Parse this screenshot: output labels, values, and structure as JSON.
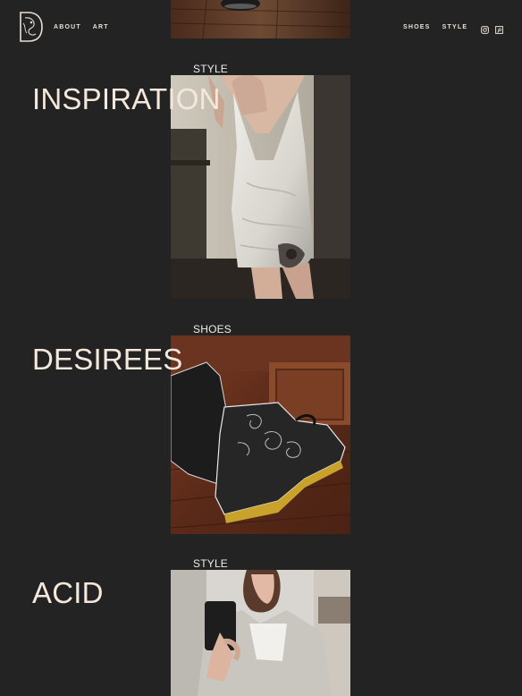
{
  "header": {
    "nav_left": [
      "ABOUT",
      "ART"
    ],
    "nav_right": [
      "SHOES",
      "STYLE"
    ],
    "social_icons": [
      "instagram-icon",
      "pinterest-icon"
    ]
  },
  "posts": [
    {
      "category": "STYLE",
      "title": "INSPIRATION"
    },
    {
      "category": "SHOES",
      "title": "DESIREES"
    },
    {
      "category": "STYLE",
      "title": "ACID"
    }
  ],
  "colors": {
    "background": "#232323",
    "text": "#f4e8dc"
  }
}
